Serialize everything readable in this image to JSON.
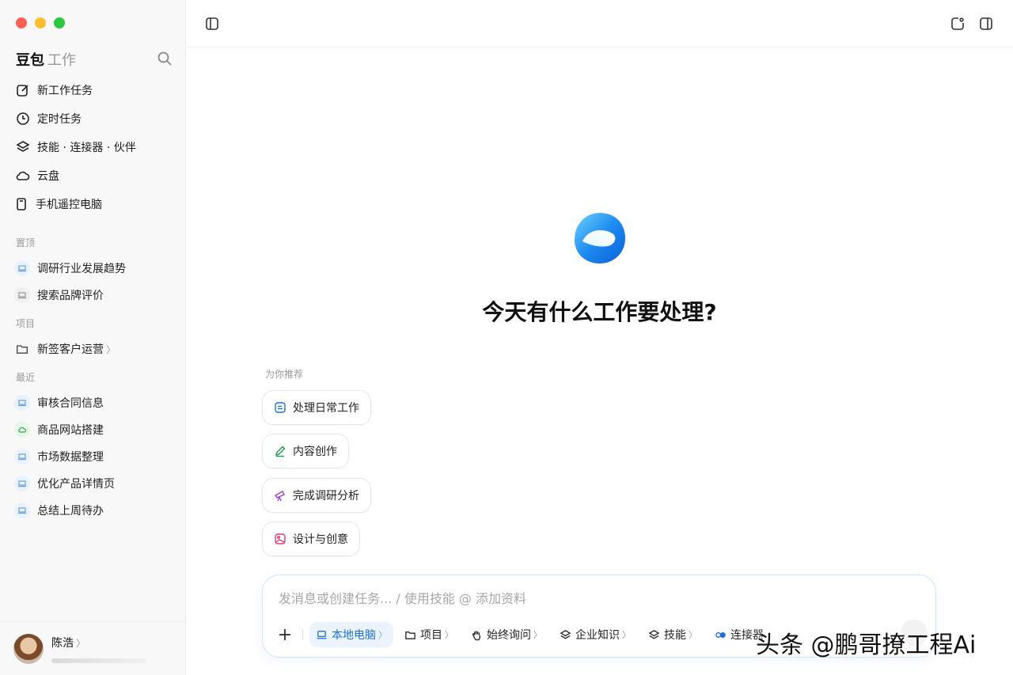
{
  "window": {
    "colors": {
      "close": "#ff5f57",
      "minimize": "#febc2e",
      "maximize": "#28c840"
    }
  },
  "brand": {
    "name": "豆包",
    "sub": "工作"
  },
  "nav": [
    {
      "label": "新工作任务",
      "icon": "edit-icon"
    },
    {
      "label": "定时任务",
      "icon": "clock-icon"
    },
    {
      "label": "技能 · 连接器 · 伙伴",
      "icon": "layers-icon"
    },
    {
      "label": "云盘",
      "icon": "cloud-icon"
    },
    {
      "label": "手机遥控电脑",
      "icon": "phone-icon"
    }
  ],
  "sections": {
    "pinned": {
      "label": "置顶",
      "items": [
        "调研行业发展趋势",
        "搜索品牌评价"
      ]
    },
    "projects": {
      "label": "项目",
      "items": [
        "新签客户运营"
      ],
      "chevron": "〉"
    },
    "recent": {
      "label": "最近",
      "items": [
        "审核合同信息",
        "商品网站搭建",
        "市场数据整理",
        "优化产品详情页",
        "总结上周待办"
      ]
    }
  },
  "user": {
    "name": "陈浩",
    "chevron": "〉"
  },
  "main": {
    "headline": "今天有什么工作要处理?",
    "rec_label": "为你推荐",
    "chips": [
      "处理日常工作",
      "内容创作",
      "完成调研分析",
      "设计与创意"
    ],
    "composer": {
      "placeholder": "发消息或创建任务... / 使用技能 @ 添加资料",
      "tools": [
        {
          "label": "本地电脑",
          "icon": "laptop-icon",
          "active": true
        },
        {
          "label": "项目",
          "icon": "folder-icon"
        },
        {
          "label": "始终询问",
          "icon": "hand-icon"
        },
        {
          "label": "企业知识",
          "icon": "layers-icon"
        },
        {
          "label": "技能",
          "icon": "layers-icon"
        },
        {
          "label": "连接器",
          "icon": "connector-icon"
        }
      ],
      "chevron": "〉",
      "plus": "+"
    }
  },
  "watermark": "头条 @鹏哥撩工程Ai"
}
